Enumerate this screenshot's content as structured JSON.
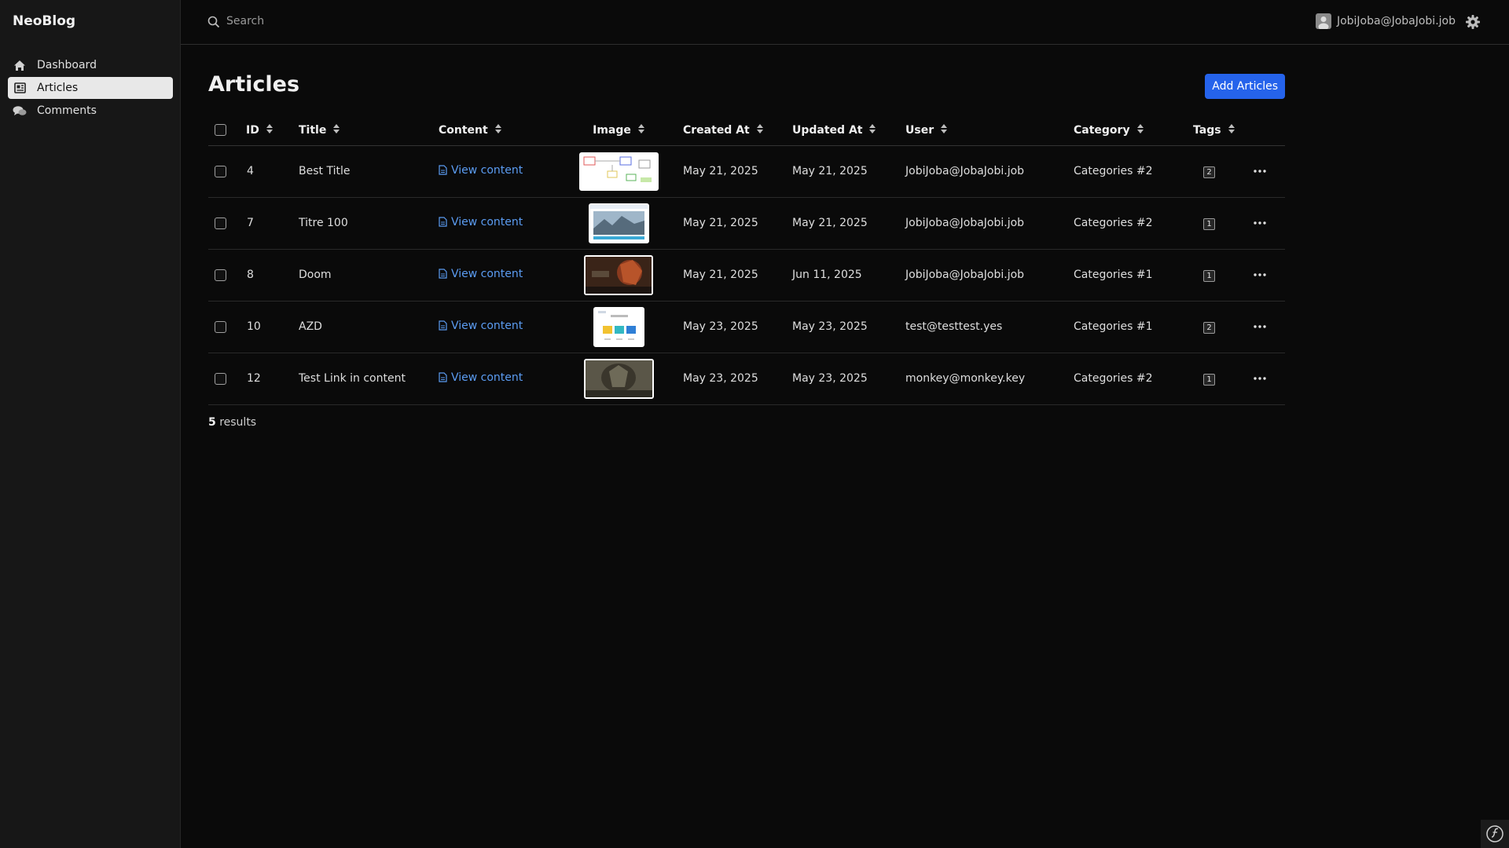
{
  "app": {
    "brand": "NeoBlog"
  },
  "sidebar": {
    "items": [
      {
        "label": "Dashboard",
        "icon": "home-icon",
        "active": false
      },
      {
        "label": "Articles",
        "icon": "newspaper-icon",
        "active": true
      },
      {
        "label": "Comments",
        "icon": "comments-icon",
        "active": false
      }
    ]
  },
  "topbar": {
    "search_placeholder": "Search",
    "user_email": "JobiJoba@JobaJobi.job"
  },
  "page": {
    "title": "Articles",
    "add_button": "Add Articles",
    "results_count": "5",
    "results_label": " results"
  },
  "table": {
    "columns": [
      "ID",
      "Title",
      "Content",
      "Image",
      "Created At",
      "Updated At",
      "User",
      "Category",
      "Tags"
    ],
    "rows": [
      {
        "id": "4",
        "title": "Best Title",
        "content": "View content",
        "created": "May 21, 2025",
        "updated": "May 21, 2025",
        "user": "JobiJoba@JobaJobi.job",
        "category": "Categories #2",
        "tags": "2"
      },
      {
        "id": "7",
        "title": "Titre 100",
        "content": "View content",
        "created": "May 21, 2025",
        "updated": "May 21, 2025",
        "user": "JobiJoba@JobaJobi.job",
        "category": "Categories #2",
        "tags": "1"
      },
      {
        "id": "8",
        "title": "Doom",
        "content": "View content",
        "created": "May 21, 2025",
        "updated": "Jun 11, 2025",
        "user": "JobiJoba@JobaJobi.job",
        "category": "Categories #1",
        "tags": "1"
      },
      {
        "id": "10",
        "title": "AZD",
        "content": "View content",
        "created": "May 23, 2025",
        "updated": "May 23, 2025",
        "user": "test@testtest.yes",
        "category": "Categories #1",
        "tags": "2"
      },
      {
        "id": "12",
        "title": "Test Link in content",
        "content": "View content",
        "created": "May 23, 2025",
        "updated": "May 23, 2025",
        "user": "monkey@monkey.key",
        "category": "Categories #2",
        "tags": "1"
      }
    ]
  },
  "colors": {
    "background": "#0a0a0a",
    "sidebar": "#171717",
    "accent": "#2563eb",
    "link": "#5b9cf2",
    "active_nav": "#e8e8e8"
  }
}
